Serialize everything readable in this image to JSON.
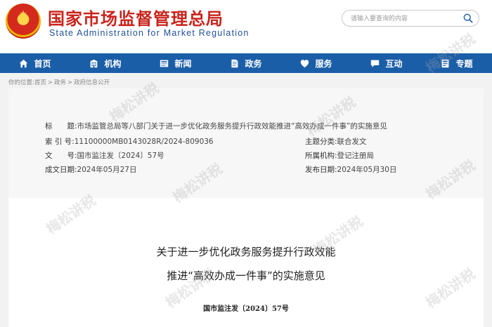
{
  "header": {
    "title_cn": "国家市场监督管理总局",
    "title_en": "State Administration for Market Regulation",
    "search_placeholder": "请输入要查询的内容"
  },
  "nav": [
    {
      "label": "首页",
      "icon": "home-icon"
    },
    {
      "label": "机构",
      "icon": "building-icon"
    },
    {
      "label": "新闻",
      "icon": "news-icon"
    },
    {
      "label": "政务",
      "icon": "government-affairs-icon"
    },
    {
      "label": "服务",
      "icon": "service-icon"
    },
    {
      "label": "互动",
      "icon": "interaction-icon"
    },
    {
      "label": "专题",
      "icon": "topic-icon"
    }
  ],
  "breadcrumb": {
    "prefix": "你的位置:",
    "items": [
      "首页",
      "政务",
      "政府信息公开"
    ],
    "separator": ">"
  },
  "meta": {
    "title_label": "标　　题:",
    "title_value": "市场监管总局等八部门关于进一步优化政务服务提升行政效能推进“高效办成一件事”的实施意见",
    "index_label": "索 引 号:",
    "index_value": "11100000MB0143028R/2024-809036",
    "category_label": "主题分类:",
    "category_value": "联合发文",
    "docno_label": "文　　号:",
    "docno_value": "国市监注发〔2024〕57号",
    "org_label": "所属机构:",
    "org_value": "登记注册局",
    "created_label": "成文日期:",
    "created_value": "2024年05月27日",
    "published_label": "发布日期:",
    "published_value": "2024年05月30日"
  },
  "document": {
    "title_line1": "关于进一步优化政务服务提升行政效能",
    "title_line2": "推进“高效办成一件事”的实施意见",
    "doc_number": "国市监注发〔2024〕57号"
  },
  "watermark": "梅松讲税",
  "colors": {
    "brand_red": "#c9241c",
    "brand_blue": "#1b5ea8",
    "english_blue": "#1f4f9a"
  }
}
